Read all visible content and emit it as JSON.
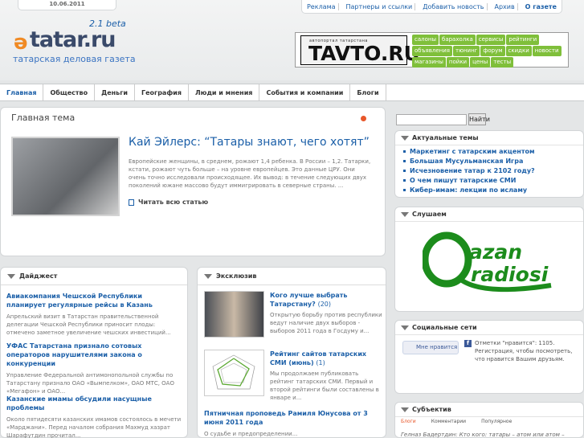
{
  "header": {
    "date": "10.06.2011",
    "top_nav": [
      "Реклама",
      "Партнеры и ссылки",
      "Добавить новость",
      "Архив",
      "О газете"
    ],
    "beta": "2.1 beta",
    "logo_mark": "ə",
    "logo_text": "tatar.ru",
    "tagline": "татарская деловая газета",
    "ad": {
      "small": "автопортал татарстана",
      "brand": "TAVTO.RU",
      "tags": [
        "салоны",
        "барахолка",
        "сервисы",
        "рейтинги",
        "объявления",
        "тюнинг",
        "форум",
        "скидки",
        "новости",
        "магазины",
        "пойки",
        "цены",
        "тесты"
      ]
    }
  },
  "main_nav": [
    "Главная",
    "Общество",
    "Деньги",
    "География",
    "Люди и мнения",
    "События и компании",
    "Блоги"
  ],
  "featured": {
    "heading": "Главная тема",
    "title": "Кай Эйлерс: “Татары знают, чего хотят”",
    "text": "Европейские женщины, в среднем, рожают 1,4 ребенка. В России – 1,2. Татарки, кстати, рожают чуть больше – на уровне европейцев. Это данные ЦРУ. Они очень точно исследовали происходящее. Их вывод: в течение следующих двух поколений южане массово будут иммигрировать в северные страны. ...",
    "read_more": "Читать всю статью"
  },
  "digest": {
    "heading": "Дайджест",
    "items": [
      {
        "title": "Авиакомпания Чешской Республики планирует регулярные рейсы в Казань",
        "text": "Апрельский визит в Татарстан правительственной делегации Чешской Республики приносит плоды: отмечено заметное увеличение чешских инвестиций..."
      },
      {
        "title": "УФАС Татарстана признало сотовых операторов нарушителями закона о конкуренции",
        "text": "Управление Федеральной антимонопольной службы по Татарстану признало ОАО «Вымпелком», ОАО МТС, ОАО «Мегафон» и ОАО..."
      },
      {
        "title": "Казанские имамы обсудили насущные проблемы",
        "text": "Около пятидесяти казанских имамов состоялось в мечети «Марджани». Перед началом собрания Махмуд хазрат Шарафутдин прочитал..."
      }
    ]
  },
  "exclusive": {
    "heading": "Эксклюзив",
    "items": [
      {
        "title": "Кого лучше выбрать Татарстану?",
        "count": "(20)",
        "text": "Открытую борьбу против республики ведут наличие двух выборов - выборов 2011 года в Госдуму и..."
      },
      {
        "title": "Рейтинг сайтов татарских СМИ (июнь)",
        "count": "(1)",
        "text": "Мы продолжаем публиковать рейтинг татарских СМИ. Первый и второй рейтинги были составлены в январе и..."
      },
      {
        "title": "Пятничная проповедь Рамиля Юнусова от 3 июня 2011 года",
        "count": "",
        "text": "О судьбе и предопределении..."
      }
    ]
  },
  "sidebar": {
    "search_button": "Найти",
    "topics_heading": "Актуальные темы",
    "topics": [
      "Маркетинг с татарским акцентом",
      "Большая Мусульманская Игра",
      "Исчезновение татар к 2102 году?",
      "О чем пишут татарские СМИ",
      "Кибер-имам: лекции по исламу"
    ],
    "listen_heading": "Слушаем",
    "radio_logo": "Qazan radiosi",
    "social_heading": "Социальные сети",
    "like_button": "Мне нравится",
    "fb_letter": "f",
    "social_text": "Отметки \"нравится\": 1105. Регистрация, чтобы посмотреть, что нравится Вашим друзьям.",
    "subjects_heading": "Субъектив",
    "subject_tabs": [
      "Блоги",
      "Комментарии",
      "Популярное"
    ],
    "subject_line": "Гелназ Бадертдин: Кто кого: татары – атом или атом –"
  },
  "colors": {
    "link": "#1b5fa8",
    "accent": "#f08a24",
    "ad_tag": "#7fbf3a"
  }
}
